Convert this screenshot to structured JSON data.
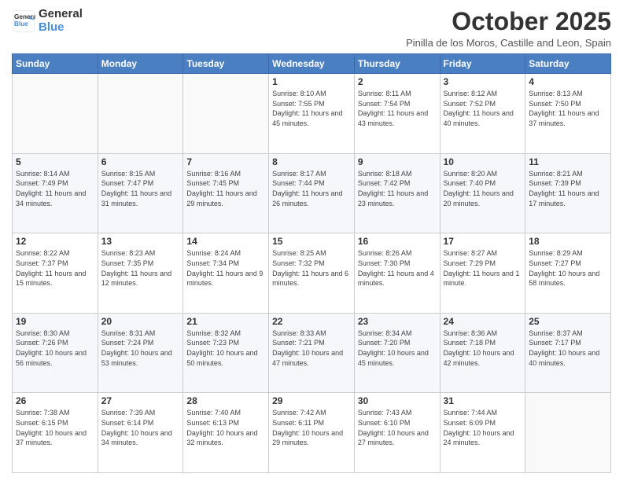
{
  "header": {
    "logo_line1": "General",
    "logo_line2": "Blue",
    "month_title": "October 2025",
    "subtitle": "Pinilla de los Moros, Castille and Leon, Spain"
  },
  "days_of_week": [
    "Sunday",
    "Monday",
    "Tuesday",
    "Wednesday",
    "Thursday",
    "Friday",
    "Saturday"
  ],
  "weeks": [
    [
      {
        "day": "",
        "info": ""
      },
      {
        "day": "",
        "info": ""
      },
      {
        "day": "",
        "info": ""
      },
      {
        "day": "1",
        "info": "Sunrise: 8:10 AM\nSunset: 7:55 PM\nDaylight: 11 hours and 45 minutes."
      },
      {
        "day": "2",
        "info": "Sunrise: 8:11 AM\nSunset: 7:54 PM\nDaylight: 11 hours and 43 minutes."
      },
      {
        "day": "3",
        "info": "Sunrise: 8:12 AM\nSunset: 7:52 PM\nDaylight: 11 hours and 40 minutes."
      },
      {
        "day": "4",
        "info": "Sunrise: 8:13 AM\nSunset: 7:50 PM\nDaylight: 11 hours and 37 minutes."
      }
    ],
    [
      {
        "day": "5",
        "info": "Sunrise: 8:14 AM\nSunset: 7:49 PM\nDaylight: 11 hours and 34 minutes."
      },
      {
        "day": "6",
        "info": "Sunrise: 8:15 AM\nSunset: 7:47 PM\nDaylight: 11 hours and 31 minutes."
      },
      {
        "day": "7",
        "info": "Sunrise: 8:16 AM\nSunset: 7:45 PM\nDaylight: 11 hours and 29 minutes."
      },
      {
        "day": "8",
        "info": "Sunrise: 8:17 AM\nSunset: 7:44 PM\nDaylight: 11 hours and 26 minutes."
      },
      {
        "day": "9",
        "info": "Sunrise: 8:18 AM\nSunset: 7:42 PM\nDaylight: 11 hours and 23 minutes."
      },
      {
        "day": "10",
        "info": "Sunrise: 8:20 AM\nSunset: 7:40 PM\nDaylight: 11 hours and 20 minutes."
      },
      {
        "day": "11",
        "info": "Sunrise: 8:21 AM\nSunset: 7:39 PM\nDaylight: 11 hours and 17 minutes."
      }
    ],
    [
      {
        "day": "12",
        "info": "Sunrise: 8:22 AM\nSunset: 7:37 PM\nDaylight: 11 hours and 15 minutes."
      },
      {
        "day": "13",
        "info": "Sunrise: 8:23 AM\nSunset: 7:35 PM\nDaylight: 11 hours and 12 minutes."
      },
      {
        "day": "14",
        "info": "Sunrise: 8:24 AM\nSunset: 7:34 PM\nDaylight: 11 hours and 9 minutes."
      },
      {
        "day": "15",
        "info": "Sunrise: 8:25 AM\nSunset: 7:32 PM\nDaylight: 11 hours and 6 minutes."
      },
      {
        "day": "16",
        "info": "Sunrise: 8:26 AM\nSunset: 7:30 PM\nDaylight: 11 hours and 4 minutes."
      },
      {
        "day": "17",
        "info": "Sunrise: 8:27 AM\nSunset: 7:29 PM\nDaylight: 11 hours and 1 minute."
      },
      {
        "day": "18",
        "info": "Sunrise: 8:29 AM\nSunset: 7:27 PM\nDaylight: 10 hours and 58 minutes."
      }
    ],
    [
      {
        "day": "19",
        "info": "Sunrise: 8:30 AM\nSunset: 7:26 PM\nDaylight: 10 hours and 56 minutes."
      },
      {
        "day": "20",
        "info": "Sunrise: 8:31 AM\nSunset: 7:24 PM\nDaylight: 10 hours and 53 minutes."
      },
      {
        "day": "21",
        "info": "Sunrise: 8:32 AM\nSunset: 7:23 PM\nDaylight: 10 hours and 50 minutes."
      },
      {
        "day": "22",
        "info": "Sunrise: 8:33 AM\nSunset: 7:21 PM\nDaylight: 10 hours and 47 minutes."
      },
      {
        "day": "23",
        "info": "Sunrise: 8:34 AM\nSunset: 7:20 PM\nDaylight: 10 hours and 45 minutes."
      },
      {
        "day": "24",
        "info": "Sunrise: 8:36 AM\nSunset: 7:18 PM\nDaylight: 10 hours and 42 minutes."
      },
      {
        "day": "25",
        "info": "Sunrise: 8:37 AM\nSunset: 7:17 PM\nDaylight: 10 hours and 40 minutes."
      }
    ],
    [
      {
        "day": "26",
        "info": "Sunrise: 7:38 AM\nSunset: 6:15 PM\nDaylight: 10 hours and 37 minutes."
      },
      {
        "day": "27",
        "info": "Sunrise: 7:39 AM\nSunset: 6:14 PM\nDaylight: 10 hours and 34 minutes."
      },
      {
        "day": "28",
        "info": "Sunrise: 7:40 AM\nSunset: 6:13 PM\nDaylight: 10 hours and 32 minutes."
      },
      {
        "day": "29",
        "info": "Sunrise: 7:42 AM\nSunset: 6:11 PM\nDaylight: 10 hours and 29 minutes."
      },
      {
        "day": "30",
        "info": "Sunrise: 7:43 AM\nSunset: 6:10 PM\nDaylight: 10 hours and 27 minutes."
      },
      {
        "day": "31",
        "info": "Sunrise: 7:44 AM\nSunset: 6:09 PM\nDaylight: 10 hours and 24 minutes."
      },
      {
        "day": "",
        "info": ""
      }
    ]
  ]
}
